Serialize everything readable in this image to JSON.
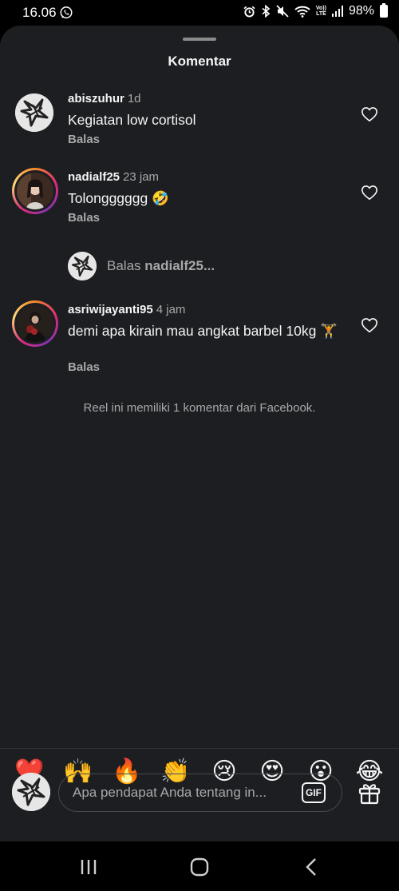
{
  "status_bar": {
    "time": "16.06",
    "battery": "98%",
    "volte_top": "Vo))",
    "volte_bottom": "LTE",
    "icons": [
      "whatsapp-icon",
      "alarm-icon",
      "bluetooth-icon",
      "mute-icon",
      "wifi-icon",
      "signal-icon",
      "battery-icon"
    ]
  },
  "sheet": {
    "title": "Komentar"
  },
  "comments": [
    {
      "user": "abiszuhur",
      "time": "1d",
      "text": "Kegiatan low cortisol",
      "reply": "Balas"
    },
    {
      "user": "nadialf25",
      "time": "23 jam",
      "text": "Tolongggggg 🤣",
      "reply": "Balas"
    },
    {
      "user": "asriwijayanti95",
      "time": "4 jam",
      "text": "demi apa kirain mau angkat barbel 10kg 🏋️",
      "reply": "Balas"
    }
  ],
  "reply_prompt": {
    "prefix": "Balas",
    "user": "nadialf25..."
  },
  "facebook_note": "Reel ini memiliki 1 komentar dari Facebook.",
  "emoji_bar": [
    "❤️",
    "🙌",
    "🔥",
    "👏",
    "😢",
    "😍",
    "😮",
    "😂"
  ],
  "composer": {
    "placeholder": "Apa pendapat Anda tentang in...",
    "gif_label": "GIF"
  },
  "colors": {
    "sheet_bg": "#1c1e21",
    "secondary_text": "#a8a8a8",
    "primary_text": "#f5f5f5"
  }
}
